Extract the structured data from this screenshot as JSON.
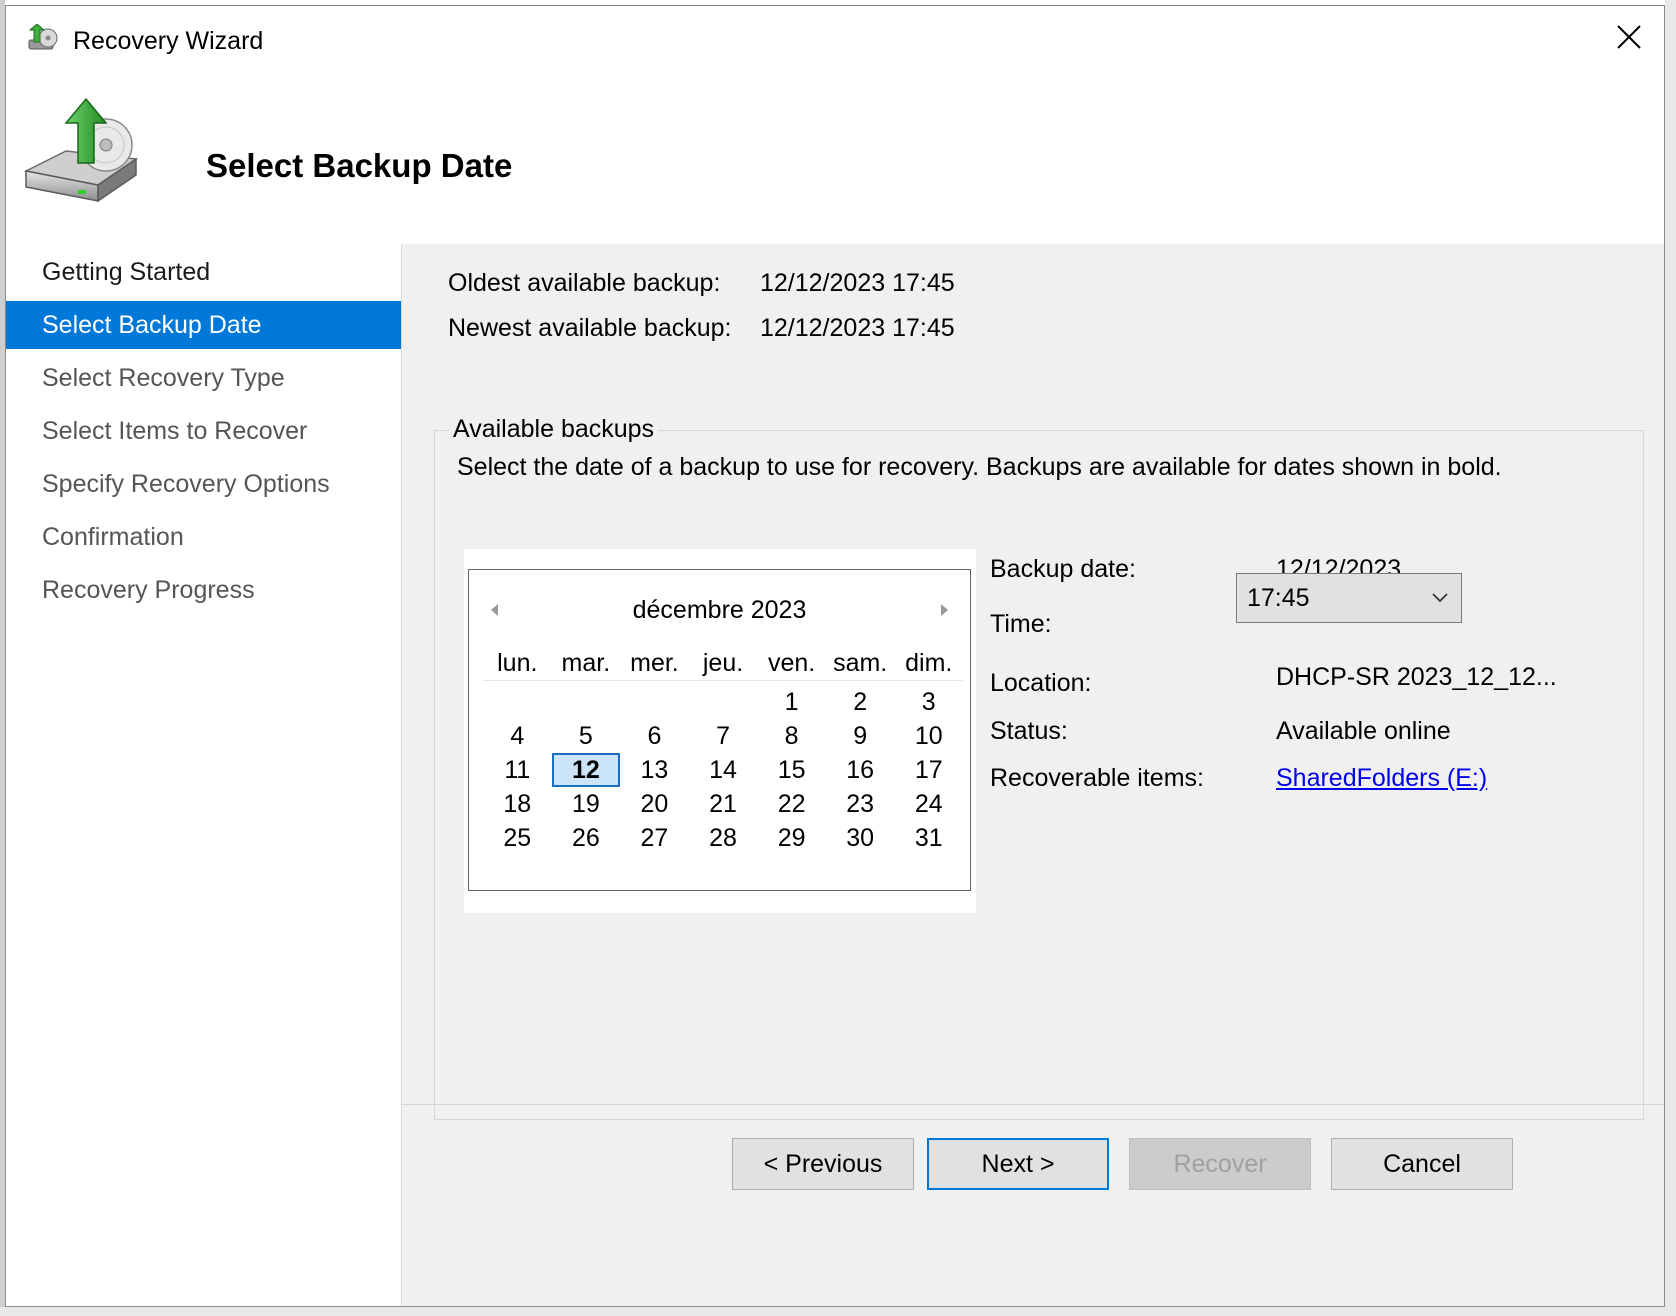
{
  "window": {
    "title": "Recovery Wizard",
    "close_glyph": "✕"
  },
  "header": {
    "title": "Select Backup Date",
    "icon": "backup-recovery-icon"
  },
  "nav": {
    "items": [
      {
        "label": "Getting Started",
        "state": "done"
      },
      {
        "label": "Select Backup Date",
        "state": "active"
      },
      {
        "label": "Select Recovery Type",
        "state": "pending"
      },
      {
        "label": "Select Items to Recover",
        "state": "pending"
      },
      {
        "label": "Specify Recovery Options",
        "state": "pending"
      },
      {
        "label": "Confirmation",
        "state": "pending"
      },
      {
        "label": "Recovery Progress",
        "state": "pending"
      }
    ]
  },
  "summary": {
    "oldest_label": "Oldest available backup:",
    "oldest_value": "12/12/2023 17:45",
    "newest_label": "Newest available backup:",
    "newest_value": "12/12/2023 17:45"
  },
  "available": {
    "title": "Available backups",
    "instruction": "Select the date of a backup to use for recovery. Backups are available for dates shown in bold."
  },
  "calendar": {
    "month": "décembre 2023",
    "weekdays": [
      "lun.",
      "mar.",
      "mer.",
      "jeu.",
      "ven.",
      "sam.",
      "dim."
    ],
    "weeks": [
      [
        "",
        "",
        "",
        "",
        "1",
        "2",
        "3"
      ],
      [
        "4",
        "5",
        "6",
        "7",
        "8",
        "9",
        "10"
      ],
      [
        "11",
        "12",
        "13",
        "14",
        "15",
        "16",
        "17"
      ],
      [
        "18",
        "19",
        "20",
        "21",
        "22",
        "23",
        "24"
      ],
      [
        "25",
        "26",
        "27",
        "28",
        "29",
        "30",
        "31"
      ]
    ],
    "selected_day": "12",
    "bold_days": [
      "12"
    ]
  },
  "details": {
    "backup_date_label": "Backup date:",
    "backup_date_value": "12/12/2023",
    "time_label": "Time:",
    "time_value": "17:45",
    "location_label": "Location:",
    "location_value": "DHCP-SR 2023_12_12...",
    "status_label": "Status:",
    "status_value": "Available online",
    "items_label": "Recoverable items:",
    "items_value": "SharedFolders (E:)"
  },
  "buttons": {
    "previous": "< Previous",
    "next": "Next >",
    "recover": "Recover",
    "cancel": "Cancel"
  },
  "colors": {
    "accent": "#0078d7",
    "link": "#0000ee",
    "panel_bg": "#f0f0f0"
  }
}
